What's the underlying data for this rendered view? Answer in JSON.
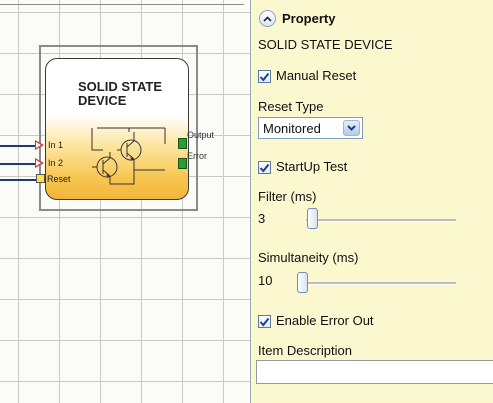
{
  "block": {
    "title_line1": "SOLID STATE",
    "title_line2": "DEVICE",
    "inputs": [
      {
        "label": "In 1"
      },
      {
        "label": "In 2"
      },
      {
        "label": "Reset"
      }
    ],
    "outputs": [
      {
        "label": "Output"
      },
      {
        "label": "Error"
      }
    ]
  },
  "property_panel": {
    "header": "Property",
    "device_name": "SOLID STATE DEVICE",
    "manual_reset": {
      "label": "Manual Reset",
      "checked": true
    },
    "reset_type": {
      "label": "Reset Type",
      "selected": "Monitored"
    },
    "startup_test": {
      "label": "StartUp Test",
      "checked": true
    },
    "filter": {
      "label": "Filter (ms)",
      "value": "3",
      "slider_position": 0.0
    },
    "simultaneity": {
      "label": "Simultaneity (ms)",
      "value": "10",
      "slider_position": 0.0
    },
    "enable_error_out": {
      "label": "Enable Error Out",
      "checked": true
    },
    "item_description": {
      "label": "Item Description",
      "value": ""
    }
  },
  "colors": {
    "property_bg": "#fbf7cf",
    "block_gradient_bottom": "#f3b53a",
    "output_port": "#2f9a2f",
    "input_arrow": "#e23030",
    "reset_port": "#ffe14d"
  },
  "icons": [
    "chevron-up-icon",
    "checkmark-icon",
    "dropdown-arrow-icon",
    "transistor-icon"
  ]
}
